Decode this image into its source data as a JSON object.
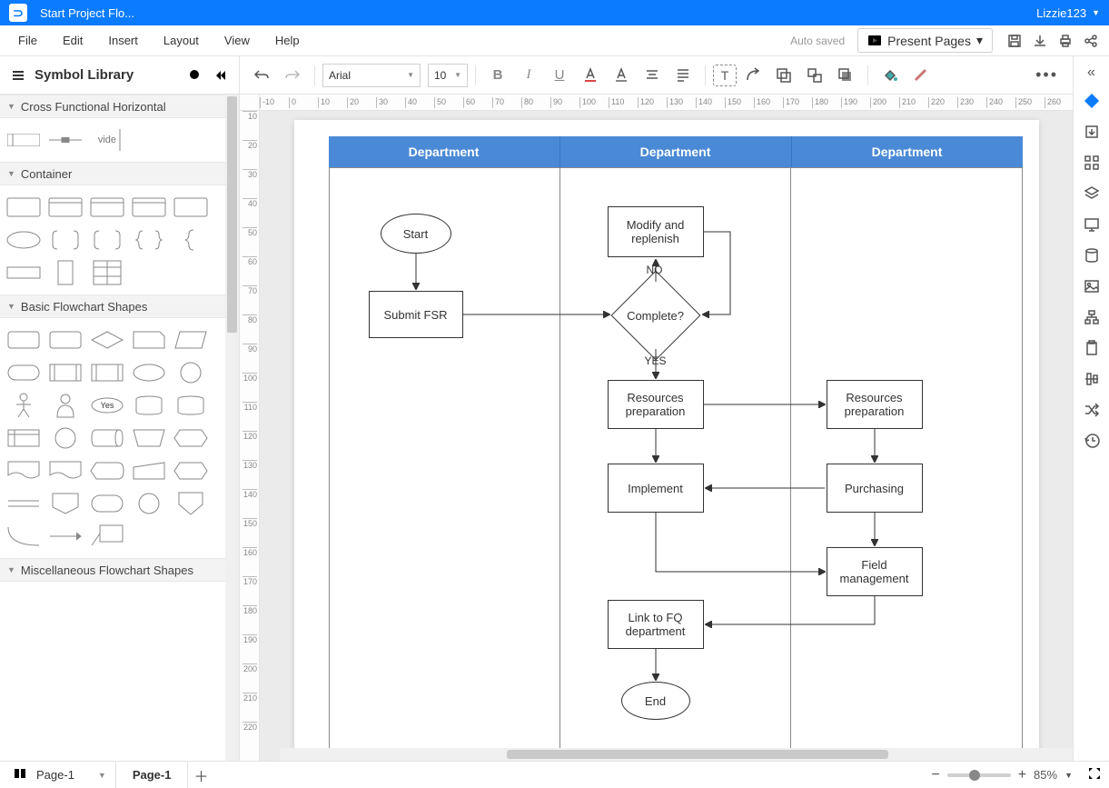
{
  "titlebar": {
    "app_title": "Start Project Flo...",
    "username": "Lizzie123"
  },
  "menubar": {
    "items": [
      "File",
      "Edit",
      "Insert",
      "Layout",
      "View",
      "Help"
    ],
    "autosaved": "Auto saved",
    "present": "Present Pages"
  },
  "leftpanel": {
    "title": "Symbol Library",
    "categories": [
      {
        "name": "Cross Functional Horizontal"
      },
      {
        "name": "Container"
      },
      {
        "name": "Basic Flowchart Shapes"
      },
      {
        "name": "Miscellaneous Flowchart Shapes"
      }
    ],
    "vide_label": "vide",
    "yes_label": "Yes"
  },
  "toolbar": {
    "font": "Arial",
    "size": "10"
  },
  "ruler_h": [
    "-10",
    "0",
    "10",
    "20",
    "30",
    "40",
    "50",
    "60",
    "70",
    "80",
    "90",
    "100",
    "110",
    "120",
    "130",
    "140",
    "150",
    "160",
    "170",
    "180",
    "190",
    "200",
    "210",
    "220",
    "230",
    "240",
    "250",
    "260"
  ],
  "ruler_v": [
    "10",
    "20",
    "30",
    "40",
    "50",
    "60",
    "70",
    "80",
    "90",
    "100",
    "110",
    "120",
    "130",
    "140",
    "150",
    "160",
    "170",
    "180",
    "190",
    "200",
    "210",
    "220"
  ],
  "swimlane": {
    "headers": [
      "Department",
      "Department",
      "Department"
    ]
  },
  "nodes": {
    "start": "Start",
    "submit": "Submit FSR",
    "modify": "Modify and replenish",
    "complete": "Complete?",
    "no": "NO",
    "yes": "YES",
    "res1": "Resources preparation",
    "res2": "Resources preparation",
    "implement": "Implement",
    "purchasing": "Purchasing",
    "field": "Field management",
    "link": "Link to FQ department",
    "end": "End"
  },
  "bottombar": {
    "page_sel": "Page-1",
    "tab": "Page-1",
    "zoom": "85%"
  }
}
